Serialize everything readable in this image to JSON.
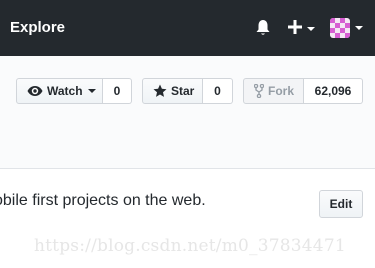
{
  "topbar": {
    "title": "Explore",
    "icons": {
      "notifications": "bell-icon",
      "create": "plus-icon",
      "avatar": "user-avatar"
    }
  },
  "repo_actions": {
    "watch": {
      "label": "Watch",
      "count": "0"
    },
    "star": {
      "label": "Star",
      "count": "0"
    },
    "fork": {
      "label": "Fork",
      "count": "62,096"
    }
  },
  "about": {
    "description": "obile first projects on the web.",
    "edit_label": "Edit"
  },
  "watermark": "https://blog.csdn.net/m0_37834471",
  "colors": {
    "header": "#24292e",
    "fork_disabled": "#959da5",
    "avatar_accent": "#d65fd2"
  }
}
